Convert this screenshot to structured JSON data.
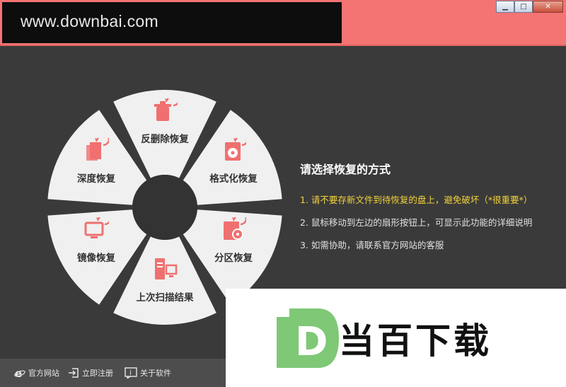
{
  "titlebar": {
    "logo_text": "www.downbai.com"
  },
  "window_controls": {
    "minimize": "▁",
    "maximize": "□",
    "close": "✕"
  },
  "wheel": {
    "segments": [
      {
        "label": "反删除恢复",
        "icon": "trash-restore-icon"
      },
      {
        "label": "格式化恢复",
        "icon": "disk-format-icon"
      },
      {
        "label": "分区恢复",
        "icon": "partition-icon"
      },
      {
        "label": "上次扫描结果",
        "icon": "computer-scan-icon"
      },
      {
        "label": "镜像恢复",
        "icon": "monitor-image-icon"
      },
      {
        "label": "深度恢复",
        "icon": "files-deep-icon"
      }
    ]
  },
  "info": {
    "title": "请选择恢复的方式",
    "lines": [
      "1. 请不要存新文件到待恢复的盘上，避免破坏（*很重要*）",
      "2. 鼠标移动到左边的扇形按钮上，可显示此功能的详细说明",
      "3. 如需协助，请联系官方网站的客服"
    ]
  },
  "bottombar": {
    "website": "官方网站",
    "register": "立即注册",
    "about": "关于软件"
  },
  "watermark": {
    "text": "当百下载",
    "logo_letter": "D"
  },
  "colors": {
    "accent": "#f47474",
    "icon": "#f07070",
    "segment": "#f0f0f0",
    "background": "#3a3a3a"
  }
}
